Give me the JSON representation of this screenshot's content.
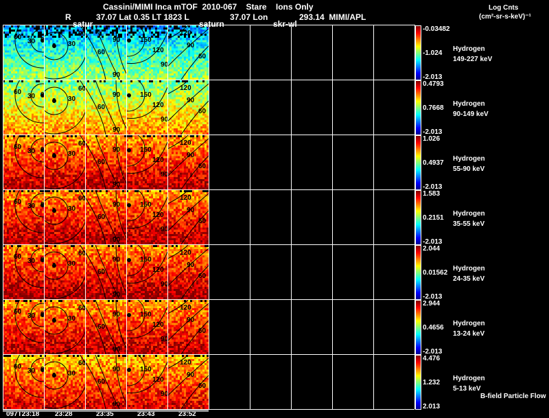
{
  "header": {
    "title": "Cassini/MIMI Inca mTOF  2010-067    Stare    Ions Only",
    "r_label": "R",
    "coords": "37.07 Lat 0.35 LT 1823 L",
    "lon": "37.07 Lon",
    "lon_value": "293.14  MIMI/APL",
    "overlay1": "satur",
    "overlay2": "saturn",
    "overlay3": "skr-wl"
  },
  "units": {
    "line1": "Log Cnts",
    "line2": "(cm²-sr-s-keV)⁻¹"
  },
  "footer_label": "B-field Particle Flow",
  "colors": {
    "background": "#000000",
    "grid": "#ffffff",
    "contour": "#000000",
    "colormap": "jet"
  },
  "chart_data": {
    "type": "heatmap",
    "x_tick_labels": [
      "097T23:18",
      "23:28",
      "23:35",
      "23:43",
      "23:52"
    ],
    "contour_labels": [
      [
        "60",
        "30",
        "0"
      ],
      [
        "0",
        "30",
        "60"
      ],
      [
        "90",
        "60",
        "90"
      ],
      [
        "150",
        "120",
        "90"
      ],
      [
        "120",
        "90",
        "60"
      ]
    ],
    "rows": [
      {
        "species": "Hydrogen",
        "energy": "149-227 keV",
        "cbar_max": "-0.03482",
        "cbar_mid": "-1.024",
        "cbar_min": "-2.013"
      },
      {
        "species": "Hydrogen",
        "energy": "90-149 keV",
        "cbar_max": "0.4793",
        "cbar_mid": "0.7668",
        "cbar_min": "-2.013"
      },
      {
        "species": "Hydrogen",
        "energy": "55-90 keV",
        "cbar_max": "1.026",
        "cbar_mid": "0.4937",
        "cbar_min": "-2.013"
      },
      {
        "species": "Hydrogen",
        "energy": "35-55 keV",
        "cbar_max": "1.583",
        "cbar_mid": "0.2151",
        "cbar_min": "-2.013"
      },
      {
        "species": "Hydrogen",
        "energy": "24-35 keV",
        "cbar_max": "2.044",
        "cbar_mid": "0.01562",
        "cbar_min": "-2.013"
      },
      {
        "species": "Hydrogen",
        "energy": "13-24 keV",
        "cbar_max": "2.944",
        "cbar_mid": "0.4656",
        "cbar_min": "-2.013"
      },
      {
        "species": "Hydrogen",
        "energy": "5-13 keV",
        "cbar_max": "4.476",
        "cbar_mid": "1.232",
        "cbar_min": "2.013"
      }
    ]
  }
}
